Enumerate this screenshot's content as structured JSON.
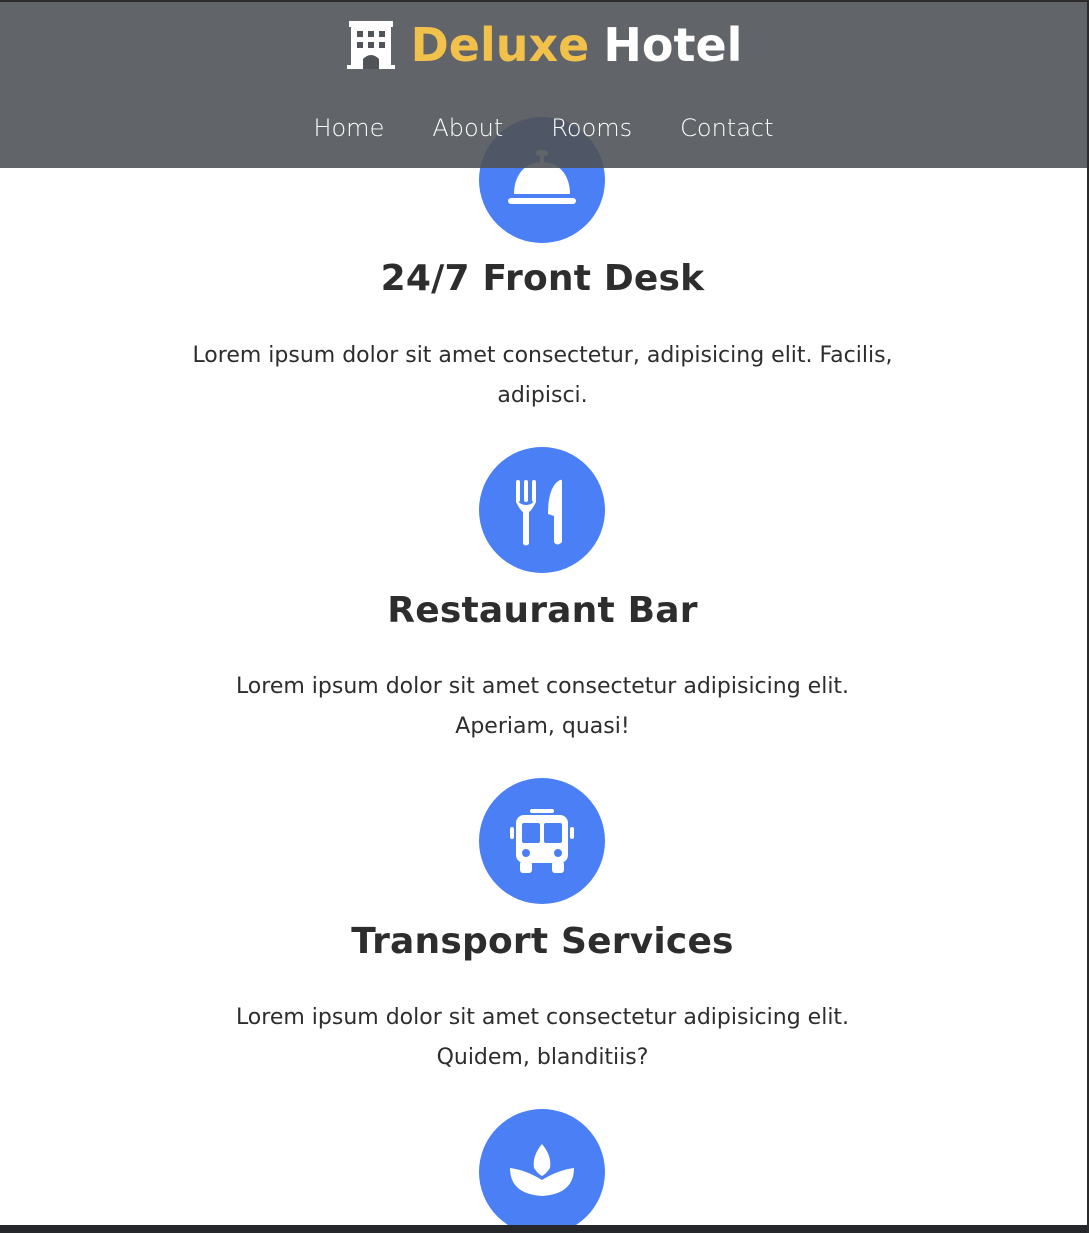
{
  "header": {
    "brand_accent": "Deluxe",
    "brand_rest": "Hotel",
    "brand_icon": "hotel-building-icon",
    "accent_color": "#f2c14b",
    "background_color": "#505358"
  },
  "nav": {
    "items": [
      {
        "label": "Home"
      },
      {
        "label": "About"
      },
      {
        "label": "Rooms"
      },
      {
        "label": "Contact"
      }
    ]
  },
  "services": {
    "icon_color": "#4a7ff6",
    "items": [
      {
        "icon": "concierge-bell-icon",
        "title": "24/7 Front Desk",
        "description": "Lorem ipsum dolor sit amet consectetur, adipisicing elit. Facilis, adipisci."
      },
      {
        "icon": "utensils-icon",
        "title": "Restaurant Bar",
        "description": "Lorem ipsum dolor sit amet consectetur adipisicing elit. Aperiam, quasi!"
      },
      {
        "icon": "bus-icon",
        "title": "Transport Services",
        "description": "Lorem ipsum dolor sit amet consectetur adipisicing elit. Quidem, blanditiis?"
      },
      {
        "icon": "spa-lotus-icon",
        "title": "",
        "description": ""
      }
    ]
  }
}
